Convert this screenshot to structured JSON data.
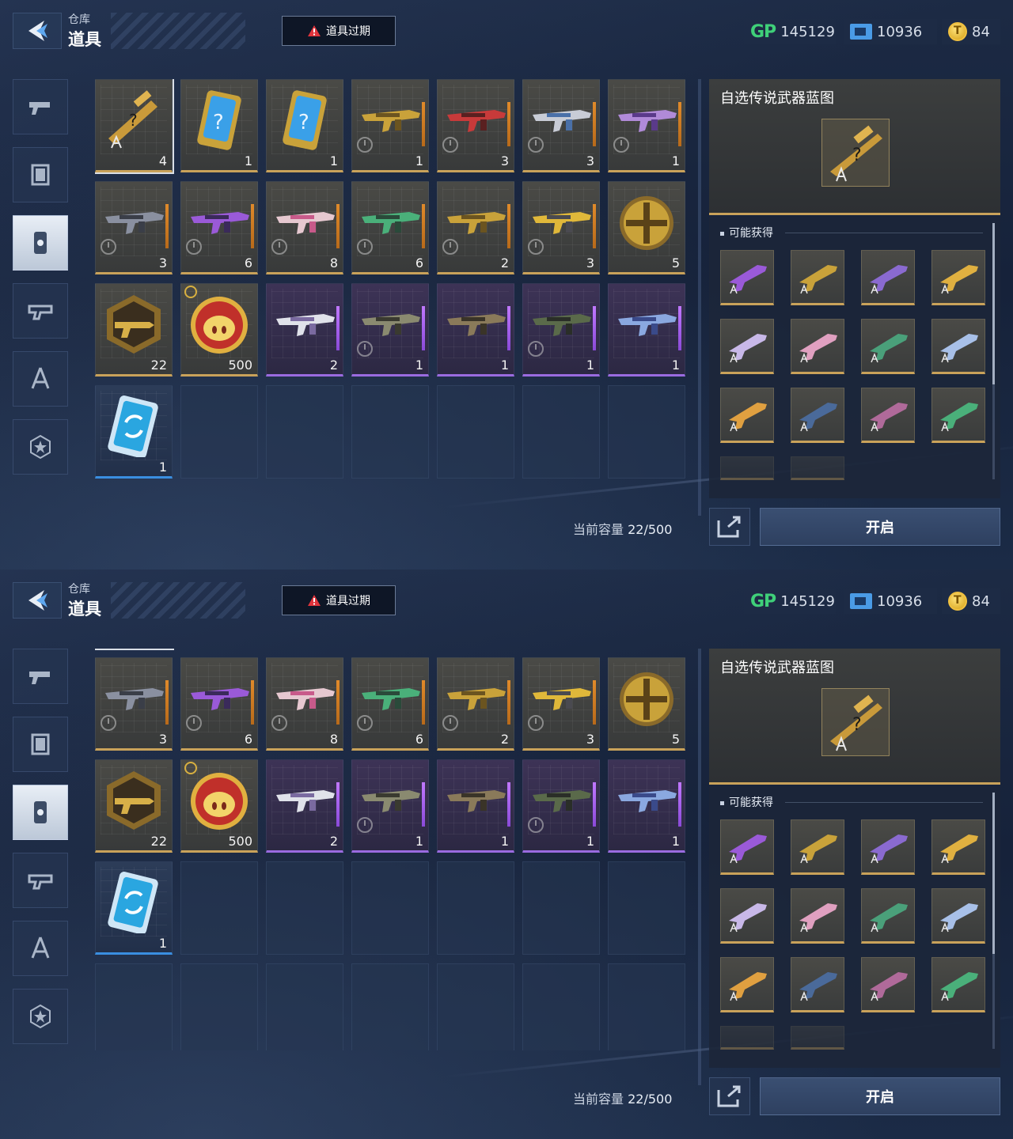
{
  "header": {
    "breadcrumb_parent": "仓库",
    "title": "道具",
    "expire_button": "道具过期"
  },
  "currency": {
    "gp_label": "GP",
    "gp_value": "145129",
    "ticket_value": "10936",
    "coin_value": "84"
  },
  "sidebar": {
    "tabs": [
      {
        "icon": "pistol-icon"
      },
      {
        "icon": "frame-icon"
      },
      {
        "icon": "item-card-icon",
        "active": true
      },
      {
        "icon": "gun-parts-icon"
      },
      {
        "icon": "blueprint-compass-icon"
      },
      {
        "icon": "star-badge-icon"
      }
    ]
  },
  "inventory": {
    "rows": [
      [
        {
          "kind": "blueprint",
          "qty": "4",
          "selected": true
        },
        {
          "kind": "mystery-card",
          "qty": "1"
        },
        {
          "kind": "mystery-card",
          "qty": "1"
        },
        {
          "kind": "gun-gold",
          "qty": "1",
          "timed": true
        },
        {
          "kind": "gun-red",
          "qty": "3",
          "timed": true
        },
        {
          "kind": "gun-silver",
          "qty": "3",
          "timed": true
        },
        {
          "kind": "gun-purple",
          "qty": "1",
          "timed": true
        }
      ],
      [
        {
          "kind": "gun-dark",
          "qty": "3",
          "timed": true
        },
        {
          "kind": "gun-violet",
          "qty": "6",
          "timed": true
        },
        {
          "kind": "gun-pink",
          "qty": "8",
          "timed": true
        },
        {
          "kind": "gun-green",
          "qty": "6",
          "timed": true
        },
        {
          "kind": "gun-gold",
          "qty": "2",
          "timed": true
        },
        {
          "kind": "gun-yellow",
          "qty": "3",
          "timed": true
        },
        {
          "kind": "gold-medal",
          "qty": "5"
        }
      ],
      [
        {
          "kind": "weapon-badge",
          "qty": "22"
        },
        {
          "kind": "pig-coin",
          "qty": "500",
          "timer_badge": true
        },
        {
          "kind": "gun-white",
          "qty": "2",
          "rarity": "purple"
        },
        {
          "kind": "gun-camo",
          "qty": "1",
          "rarity": "purple",
          "timed": true
        },
        {
          "kind": "gun-brown",
          "qty": "1",
          "rarity": "purple"
        },
        {
          "kind": "gun-olive",
          "qty": "1",
          "rarity": "purple",
          "timed": true
        },
        {
          "kind": "gun-blue",
          "qty": "1",
          "rarity": "purple"
        }
      ],
      [
        {
          "kind": "refresh-card",
          "qty": "1",
          "rarity": "blue"
        }
      ]
    ],
    "capacity_label": "当前容量",
    "capacity_value": "22/500"
  },
  "detail": {
    "title": "自选传说武器蓝图",
    "possible_label": "可能获得",
    "rewards": [
      "purple",
      "gold-dark",
      "violet",
      "gold-yellow",
      "silver-purple",
      "pink",
      "green-red",
      "silver-blue",
      "gold-orange",
      "camo-blue",
      "dark-pink",
      "green"
    ],
    "open_button": "开启"
  },
  "colors": {
    "gold_rarity": "#c9a25a",
    "purple_rarity": "#9a6be0",
    "blue_rarity": "#3a8ee0",
    "gp_green": "#3fd079",
    "warning_red": "#e0343c"
  }
}
